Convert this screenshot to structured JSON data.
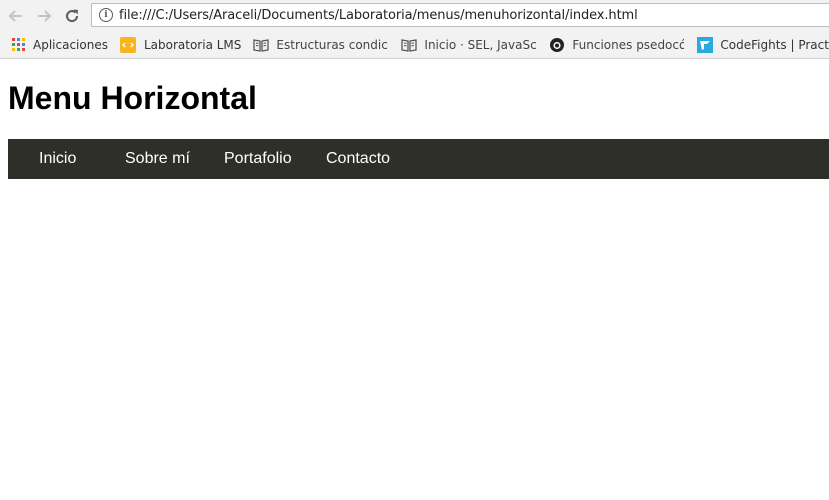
{
  "browser": {
    "address_bar": {
      "url": "file:///C:/Users/Araceli/Documents/Laboratoria/menus/menuhorizontal/index.html"
    },
    "bookmarks": [
      {
        "label": "Aplicaciones",
        "icon": "apps-grid-icon"
      },
      {
        "label": "Laboratoria LMS",
        "icon": "laboratoria-icon"
      },
      {
        "label": "Estructuras condicion",
        "icon": "book-icon"
      },
      {
        "label": "Inicio · SEL, JavaScript",
        "icon": "book-icon"
      },
      {
        "label": "Funciones psedocódi",
        "icon": "github-icon"
      },
      {
        "label": "CodeFights | Practice",
        "icon": "codefights-icon"
      }
    ]
  },
  "page": {
    "title": "Menu Horizontal",
    "menu": {
      "items": [
        {
          "label": "Inicio"
        },
        {
          "label": "Sobre mí"
        },
        {
          "label": "Portafolio"
        },
        {
          "label": "Contacto"
        }
      ],
      "background_color": "#2f2f2a",
      "text_color": "#ffffff"
    }
  }
}
